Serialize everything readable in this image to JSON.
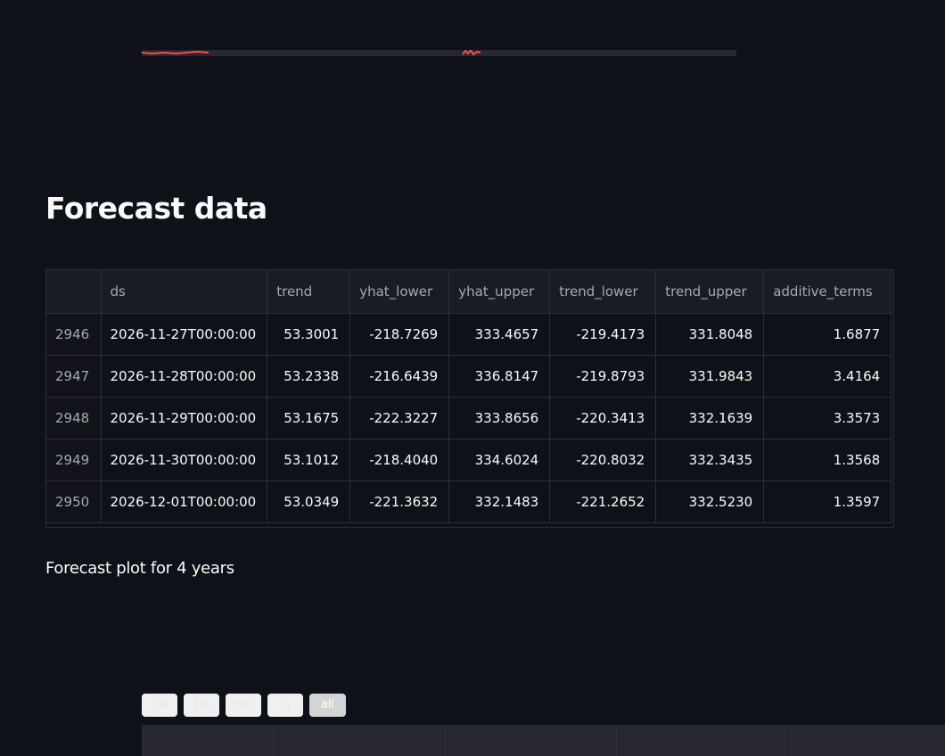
{
  "heading": "Forecast data",
  "subtitle": "Forecast plot for 4 years",
  "table": {
    "columns": [
      "",
      "ds",
      "trend",
      "yhat_lower",
      "yhat_upper",
      "trend_lower",
      "trend_upper",
      "additive_terms"
    ],
    "rows": [
      [
        "2946",
        "2026-11-27T00:00:00",
        "53.3001",
        "-218.7269",
        "333.4657",
        "-219.4173",
        "331.8048",
        "1.6877"
      ],
      [
        "2947",
        "2026-11-28T00:00:00",
        "53.2338",
        "-216.6439",
        "336.8147",
        "-219.8793",
        "331.9843",
        "3.4164"
      ],
      [
        "2948",
        "2026-11-29T00:00:00",
        "53.1675",
        "-222.3227",
        "333.8656",
        "-220.3413",
        "332.1639",
        "3.3573"
      ],
      [
        "2949",
        "2026-11-30T00:00:00",
        "53.1012",
        "-218.4040",
        "334.6024",
        "-220.8032",
        "332.3435",
        "1.3568"
      ],
      [
        "2950",
        "2026-12-01T00:00:00",
        "53.0349",
        "-221.3632",
        "332.1483",
        "-221.2652",
        "332.5230",
        "1.3597"
      ]
    ]
  },
  "range_selector": {
    "buttons": [
      "1w",
      "1m",
      "6m",
      "1y",
      "all"
    ],
    "active": "all"
  },
  "colors": {
    "background": "#0e1117",
    "plot_background": "#262730",
    "series_line": "#ff4b4b"
  }
}
